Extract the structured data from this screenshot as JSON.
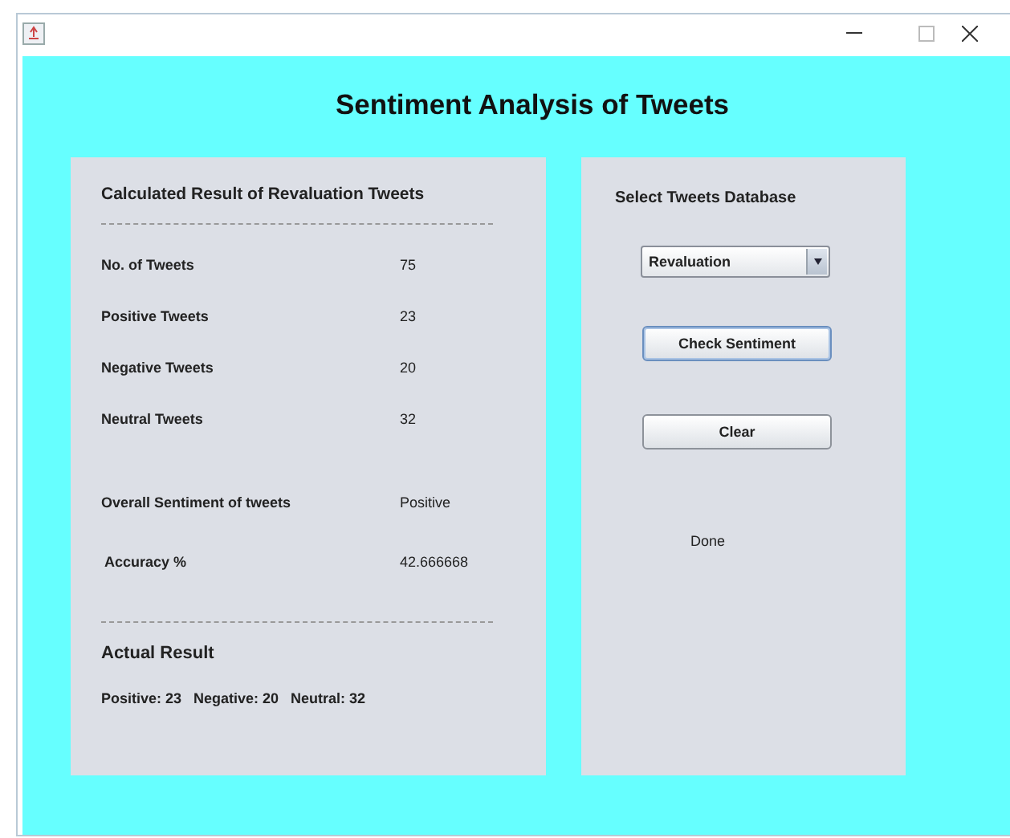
{
  "window": {
    "title": "Sentiment Analysis of Tweets"
  },
  "results": {
    "heading": "Calculated Result of Revaluation Tweets",
    "counts": [
      {
        "label": "No. of Tweets",
        "value": "75"
      },
      {
        "label": "Positive Tweets",
        "value": "23"
      },
      {
        "label": "Negative Tweets",
        "value": "20"
      },
      {
        "label": "Neutral Tweets",
        "value": "32"
      }
    ],
    "summary": [
      {
        "label": "Overall Sentiment of tweets",
        "value": "Positive"
      },
      {
        "label": "Accuracy %",
        "value": "42.666668"
      }
    ],
    "actual_heading": "Actual Result",
    "actual_text": "Positive: 23   Negative: 20   Neutral: 32"
  },
  "controls": {
    "heading": "Select Tweets Database",
    "database": "Revaluation",
    "buttons": [
      {
        "label": "Check Sentiment",
        "focused": true
      },
      {
        "label": "Clear",
        "focused": false
      }
    ],
    "status": "Done"
  }
}
